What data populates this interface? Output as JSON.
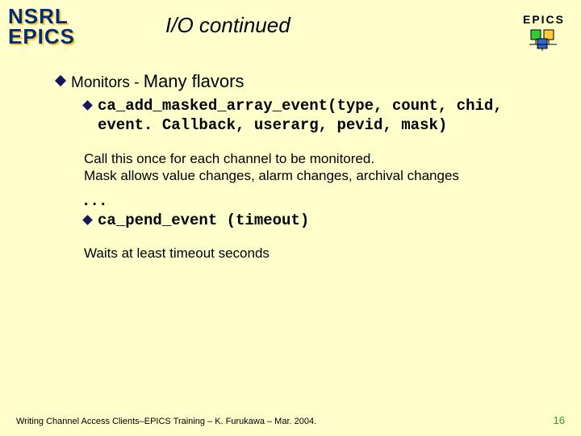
{
  "logo": {
    "line1": "NSRL",
    "line2": "EPICS"
  },
  "header": {
    "title": "I/O continued",
    "epics_label": "EPICS"
  },
  "content": {
    "monitors_label": "Monitors - ",
    "monitors_suffix": "Many flavors",
    "code1": "ca_add_masked_array_event(type, count, chid, event. Callback, userarg, pevid, mask)",
    "desc1a": "Call this once for each channel to be monitored.",
    "desc1b": "Mask allows value changes, alarm changes, archival changes",
    "more": ". . .",
    "code2": "ca_pend_event (timeout)",
    "desc2": "Waits at least timeout seconds"
  },
  "footer": {
    "left": "Writing Channel Access Clients–EPICS Training – K. Furukawa – Mar. 2004.",
    "page": "16"
  },
  "colors": {
    "icon_green": "#33cc33",
    "icon_yellow": "#ffcc33",
    "icon_blue": "#3366cc"
  }
}
